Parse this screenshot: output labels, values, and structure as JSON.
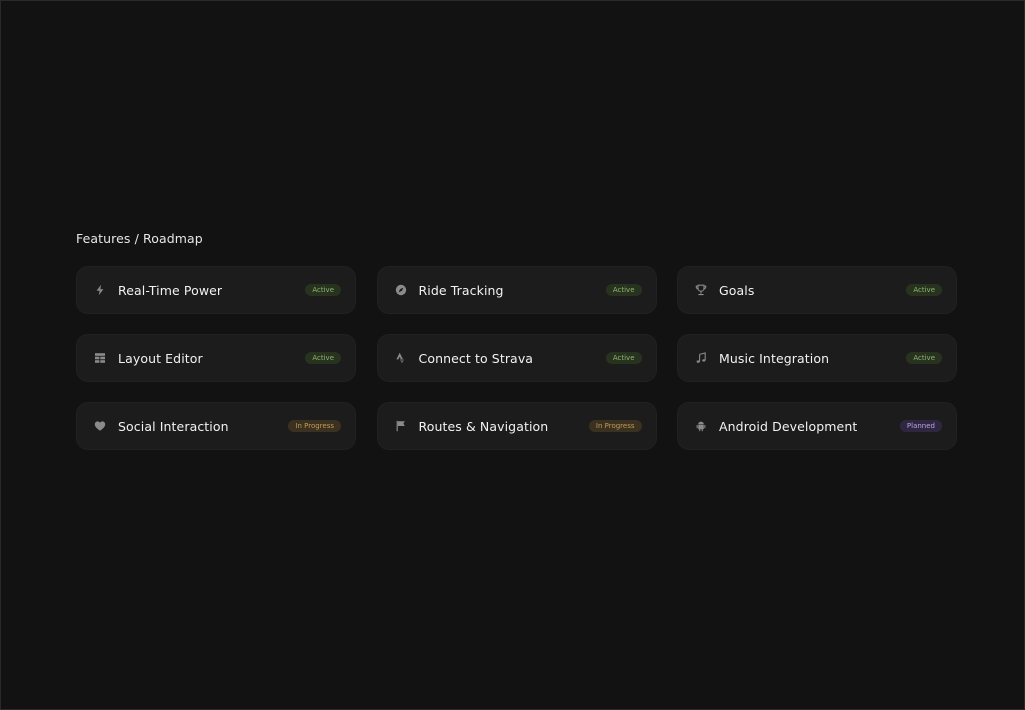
{
  "section": {
    "title": "Features / Roadmap"
  },
  "features": [
    {
      "label": "Real-Time Power",
      "icon": "lightning-icon",
      "status": "Active",
      "status_type": "active"
    },
    {
      "label": "Ride Tracking",
      "icon": "compass-icon",
      "status": "Active",
      "status_type": "active"
    },
    {
      "label": "Goals",
      "icon": "trophy-icon",
      "status": "Active",
      "status_type": "active"
    },
    {
      "label": "Layout Editor",
      "icon": "layout-grid-icon",
      "status": "Active",
      "status_type": "active"
    },
    {
      "label": "Connect to Strava",
      "icon": "strava-icon",
      "status": "Active",
      "status_type": "active"
    },
    {
      "label": "Music Integration",
      "icon": "music-note-icon",
      "status": "Active",
      "status_type": "active"
    },
    {
      "label": "Social Interaction",
      "icon": "heart-icon",
      "status": "In Progress",
      "status_type": "progress"
    },
    {
      "label": "Routes & Navigation",
      "icon": "flag-icon",
      "status": "In Progress",
      "status_type": "progress"
    },
    {
      "label": "Android Development",
      "icon": "android-icon",
      "status": "Planned",
      "status_type": "planned"
    }
  ],
  "colors": {
    "background": "#121212",
    "card": "#1c1c1c",
    "icon": "#8a8a8a",
    "active_bg": "#27321f",
    "active_text": "#8fb66f",
    "progress_bg": "#3b3120",
    "progress_text": "#c39a59",
    "planned_bg": "#2f2742",
    "planned_text": "#b9a6dc"
  }
}
